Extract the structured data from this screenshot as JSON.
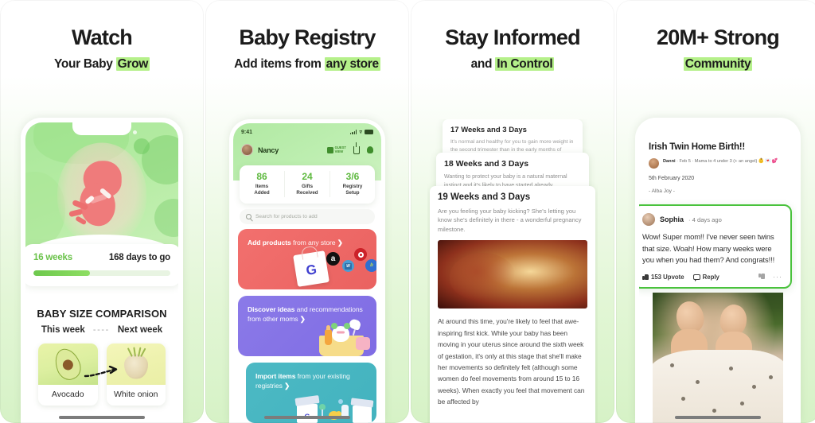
{
  "panels": [
    {
      "headline": "Watch",
      "sub_prefix": "Your Baby ",
      "sub_highlight": "Grow",
      "app": {
        "weeks_label": "16 weeks",
        "days_to_go": "168 days to go",
        "progress_percent": 41,
        "size_title": "BABY SIZE COMPARISON",
        "this_week_label": "This week",
        "next_week_label": "Next week",
        "dash": "----",
        "this_week_item": "Avocado",
        "next_week_item": "White onion"
      }
    },
    {
      "headline": "Baby Registry",
      "sub_prefix": "Add items from ",
      "sub_highlight": "any store",
      "app": {
        "status_time": "9:41",
        "user_name": "Nancy",
        "guest_view_line1": "GUEST",
        "guest_view_line2": "VIEW",
        "stats": [
          {
            "value": "86",
            "label": "Items\nAdded"
          },
          {
            "value": "24",
            "label": "Gifts\nReceived"
          },
          {
            "value": "3/6",
            "label": "Registry\nSetup"
          }
        ],
        "search_placeholder": "Search for products to add",
        "promos": [
          {
            "bold": "Add products",
            "rest": " from any store",
            "color": "#ea6260"
          },
          {
            "bold": "Discover ideas",
            "rest": " and recommendations from other moms",
            "color": "#7f6ce4"
          },
          {
            "bold": "Import items",
            "rest": " from your existing registries",
            "color": "#43b3bf"
          }
        ],
        "chevron": "❯"
      }
    },
    {
      "headline": "Stay Informed",
      "sub_prefix": "and ",
      "sub_highlight": "In Control",
      "app": {
        "cards": [
          {
            "title": "17 Weeks and 3 Days",
            "body": "It's normal and healthy for you to gain more weight in the second trimester than in the early months of pregnancy."
          },
          {
            "title": "18 Weeks and 3 Days",
            "body": "Wanting to protect your baby is a natural maternal instinct and it's likely to have started already."
          },
          {
            "title": "19 Weeks and 3 Days",
            "body": "Are you feeling your baby kicking? She's letting you know she's definitely in there - a wonderful pregnancy milestone."
          }
        ],
        "article_body": "At around this time, you're likely to feel that awe-inspiring first kick. While your baby has been moving in your uterus since around the sixth week of gestation, it's only at this stage that she'll make her movements so definitely felt (although some women do feel movements from around 15 to 16 weeks). When exactly you feel that movement can be affected by"
      }
    },
    {
      "headline": "20M+ Strong",
      "sub_prefix": "",
      "sub_highlight": "Community",
      "app": {
        "post_title": "Irish Twin Home Birth!!",
        "post_author": "Danni",
        "post_meta": "· Feb 5 · Mama to 4 under 3 (+ an angel)",
        "post_emoji": "👶💌💕",
        "post_date": "5th February 2020",
        "post_subtitle": "- Alba Joy -",
        "comment": {
          "author": "Sophia",
          "time": "· 4 days ago",
          "text": "Wow! Super mom!! I've never seen twins that size. Woah! How many weeks were you when you had them? And congrats!!!",
          "upvote_label": "153 Upvote",
          "reply_label": "Reply",
          "more_label": "···"
        }
      }
    }
  ],
  "colors": {
    "highlight": "#b5f08a",
    "accent_green": "#6ac24a",
    "comment_border": "#49c23c"
  }
}
